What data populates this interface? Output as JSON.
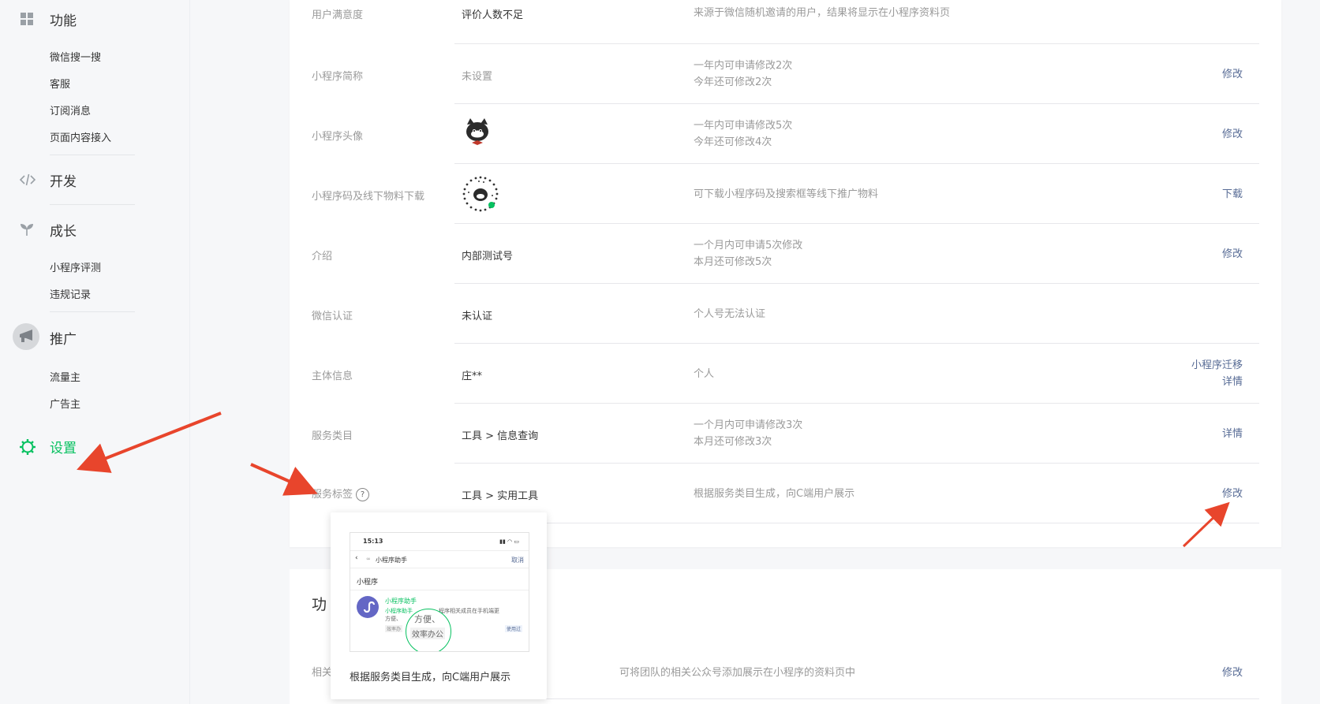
{
  "sidebar": {
    "groups": [
      {
        "title": "功能",
        "icon": "grid-icon",
        "items": [
          "微信搜一搜",
          "客服",
          "订阅消息",
          "页面内容接入"
        ]
      },
      {
        "title": "开发",
        "icon": "code-icon",
        "items": []
      },
      {
        "title": "成长",
        "icon": "sprout-icon",
        "items": [
          "小程序评测",
          "违规记录"
        ]
      },
      {
        "title": "推广",
        "icon": "megaphone-icon",
        "items": [
          "流量主",
          "广告主"
        ]
      },
      {
        "title": "设置",
        "icon": "gear-icon",
        "items": [],
        "active": true
      }
    ]
  },
  "settings": {
    "rows": [
      {
        "label": "用户满意度",
        "value": "评价人数不足",
        "desc": [
          "来源于微信随机邀请的用户，结果将显示在小程序资料页"
        ],
        "actions": []
      },
      {
        "label": "小程序简称",
        "value": "未设置",
        "desc": [
          "一年内可申请修改2次",
          "今年还可修改2次"
        ],
        "actions": [
          "修改"
        ]
      },
      {
        "label": "小程序头像",
        "value": "",
        "desc": [
          "一年内可申请修改5次",
          "今年还可修改4次"
        ],
        "actions": [
          "修改"
        ]
      },
      {
        "label": "小程序码及线下物料下载",
        "value": "",
        "desc": [
          "可下载小程序码及搜索框等线下推广物料"
        ],
        "actions": [
          "下载"
        ]
      },
      {
        "label": "介绍",
        "value": "内部测试号",
        "desc": [
          "一个月内可申请5次修改",
          "本月还可修改5次"
        ],
        "actions": [
          "修改"
        ]
      },
      {
        "label": "微信认证",
        "value": "未认证",
        "desc": [
          "个人号无法认证"
        ],
        "actions": []
      },
      {
        "label": "主体信息",
        "value": "庄**",
        "desc": [
          "个人"
        ],
        "actions": [
          "小程序迁移",
          "详情"
        ]
      },
      {
        "label": "服务类目",
        "value": "工具 > 信息查询",
        "desc": [
          "一个月内可申请修改3次",
          "本月还可修改3次"
        ],
        "actions": [
          "详情"
        ]
      },
      {
        "label": "服务标签",
        "value": "工具 > 实用工具",
        "desc": [
          "根据服务类目生成，向C端用户展示"
        ],
        "actions": [
          "修改"
        ]
      }
    ]
  },
  "section2": {
    "title_partial": "功",
    "row": {
      "label_partial": "相关",
      "desc": "可将团队的相关公众号添加展示在小程序的资料页中",
      "action": "修改"
    }
  },
  "popup": {
    "caption": "根据服务类目生成，向C端用户展示",
    "phone": {
      "time": "15:13",
      "nav_title": "小程序助手",
      "cancel": "取消",
      "section": "小程序",
      "app_name": "小程序助手",
      "app_desc_1": "小程序助手",
      "app_desc_2": "程序相关成员在手机端更",
      "app_desc_3": "方便、",
      "badge": "使用过",
      "tag_small": "效率办",
      "zoom_line": "方便、",
      "zoom_tag": "效率办公"
    }
  },
  "colors": {
    "accent": "#07c160",
    "link": "#576b95",
    "arrow": "#e8452c"
  }
}
